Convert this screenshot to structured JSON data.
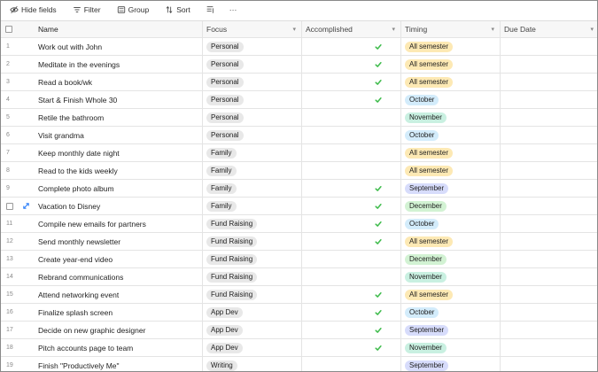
{
  "toolbar": {
    "hide_fields": "Hide fields",
    "filter": "Filter",
    "group": "Group",
    "sort": "Sort",
    "more": "···"
  },
  "columns": {
    "name": "Name",
    "focus": "Focus",
    "accomplished": "Accomplished",
    "timing": "Timing",
    "due_date": "Due Date"
  },
  "timing_colors": {
    "All semester": "#fde9b4",
    "October": "#d3ecfb",
    "November": "#c9f0e1",
    "December": "#d2f2d3",
    "September": "#d7dcfb"
  },
  "check_color": "#3dbb4a",
  "rows": [
    {
      "num": "1",
      "name": "Work out with John",
      "focus": "Personal",
      "accomplished": true,
      "timing": "All semester"
    },
    {
      "num": "2",
      "name": "Meditate in the evenings",
      "focus": "Personal",
      "accomplished": true,
      "timing": "All semester"
    },
    {
      "num": "3",
      "name": "Read a book/wk",
      "focus": "Personal",
      "accomplished": true,
      "timing": "All semester"
    },
    {
      "num": "4",
      "name": "Start & Finish Whole 30",
      "focus": "Personal",
      "accomplished": true,
      "timing": "October"
    },
    {
      "num": "5",
      "name": "Retile the bathroom",
      "focus": "Personal",
      "accomplished": false,
      "timing": "November"
    },
    {
      "num": "6",
      "name": "Visit grandma",
      "focus": "Personal",
      "accomplished": false,
      "timing": "October"
    },
    {
      "num": "7",
      "name": "Keep monthly date night",
      "focus": "Family",
      "accomplished": false,
      "timing": "All semester"
    },
    {
      "num": "8",
      "name": "Read to the kids weekly",
      "focus": "Family",
      "accomplished": false,
      "timing": "All semester"
    },
    {
      "num": "9",
      "name": "Complete photo album",
      "focus": "Family",
      "accomplished": true,
      "timing": "September"
    },
    {
      "num": "",
      "name": "Vacation to Disney",
      "focus": "Family",
      "accomplished": true,
      "timing": "December",
      "hovered": true
    },
    {
      "num": "11",
      "name": "Compile new emails for partners",
      "focus": "Fund Raising",
      "accomplished": true,
      "timing": "October"
    },
    {
      "num": "12",
      "name": "Send monthly newsletter",
      "focus": "Fund Raising",
      "accomplished": true,
      "timing": "All semester"
    },
    {
      "num": "13",
      "name": "Create year-end video",
      "focus": "Fund Raising",
      "accomplished": false,
      "timing": "December"
    },
    {
      "num": "14",
      "name": "Rebrand communications",
      "focus": "Fund Raising",
      "accomplished": false,
      "timing": "November"
    },
    {
      "num": "15",
      "name": "Attend networking event",
      "focus": "Fund Raising",
      "accomplished": true,
      "timing": "All semester"
    },
    {
      "num": "16",
      "name": "Finalize splash screen",
      "focus": "App Dev",
      "accomplished": true,
      "timing": "October"
    },
    {
      "num": "17",
      "name": "Decide on new graphic designer",
      "focus": "App Dev",
      "accomplished": true,
      "timing": "September"
    },
    {
      "num": "18",
      "name": "Pitch accounts page to team",
      "focus": "App Dev",
      "accomplished": true,
      "timing": "November"
    },
    {
      "num": "19",
      "name": "Finish \"Productively Me\"",
      "focus": "Writing",
      "accomplished": false,
      "timing": "September"
    }
  ]
}
